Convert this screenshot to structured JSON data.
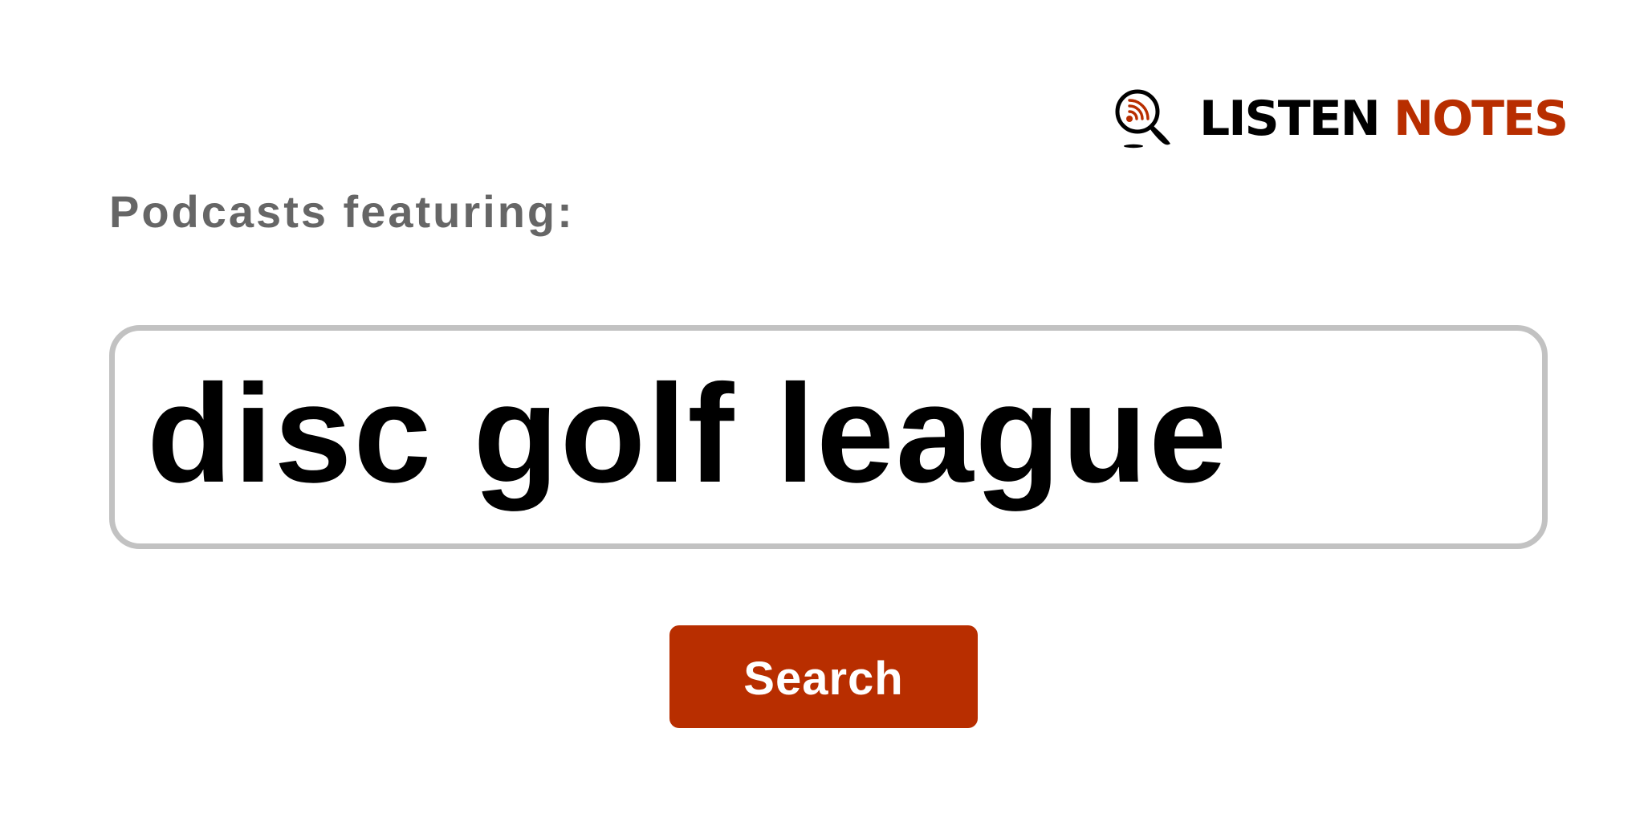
{
  "colors": {
    "brand_accent": "#b82e00",
    "muted_text": "#666666",
    "input_border": "#c2c2c2",
    "button_text": "#ffffff"
  },
  "brand": {
    "icon": "podcast-search-icon",
    "word_listen": "LISTEN",
    "word_notes": "NOTES"
  },
  "heading": {
    "text": "Podcasts featuring:"
  },
  "search": {
    "value": "disc golf league"
  },
  "button": {
    "label": "Search"
  }
}
